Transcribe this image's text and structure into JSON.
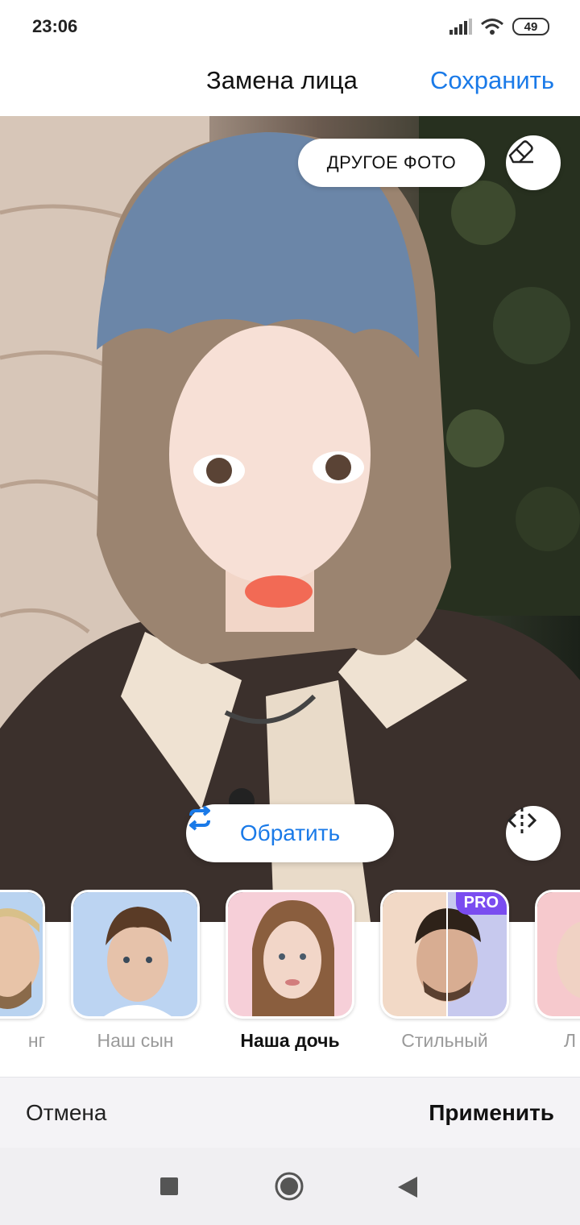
{
  "status_bar": {
    "time": "23:06",
    "battery": "49"
  },
  "header": {
    "title": "Замена лица",
    "save_label": "Сохранить"
  },
  "photo": {
    "other_photo_label": "ДРУГОЕ ФОТО",
    "eraser_icon": "eraser-icon",
    "revert_label": "Обратить",
    "revert_icon": "swap-arrows-icon",
    "compare_icon": "compare-split-icon"
  },
  "filters": [
    {
      "label": "нг"
    },
    {
      "label": "Наш сын"
    },
    {
      "label": "Наша дочь",
      "active": true
    },
    {
      "label": "Стильный",
      "badge": "PRO"
    },
    {
      "label": "Л"
    }
  ],
  "actions": {
    "cancel_label": "Отмена",
    "apply_label": "Применить"
  },
  "colors": {
    "accent": "#1a7ae8",
    "pro_badge": "#7a4cf0"
  }
}
